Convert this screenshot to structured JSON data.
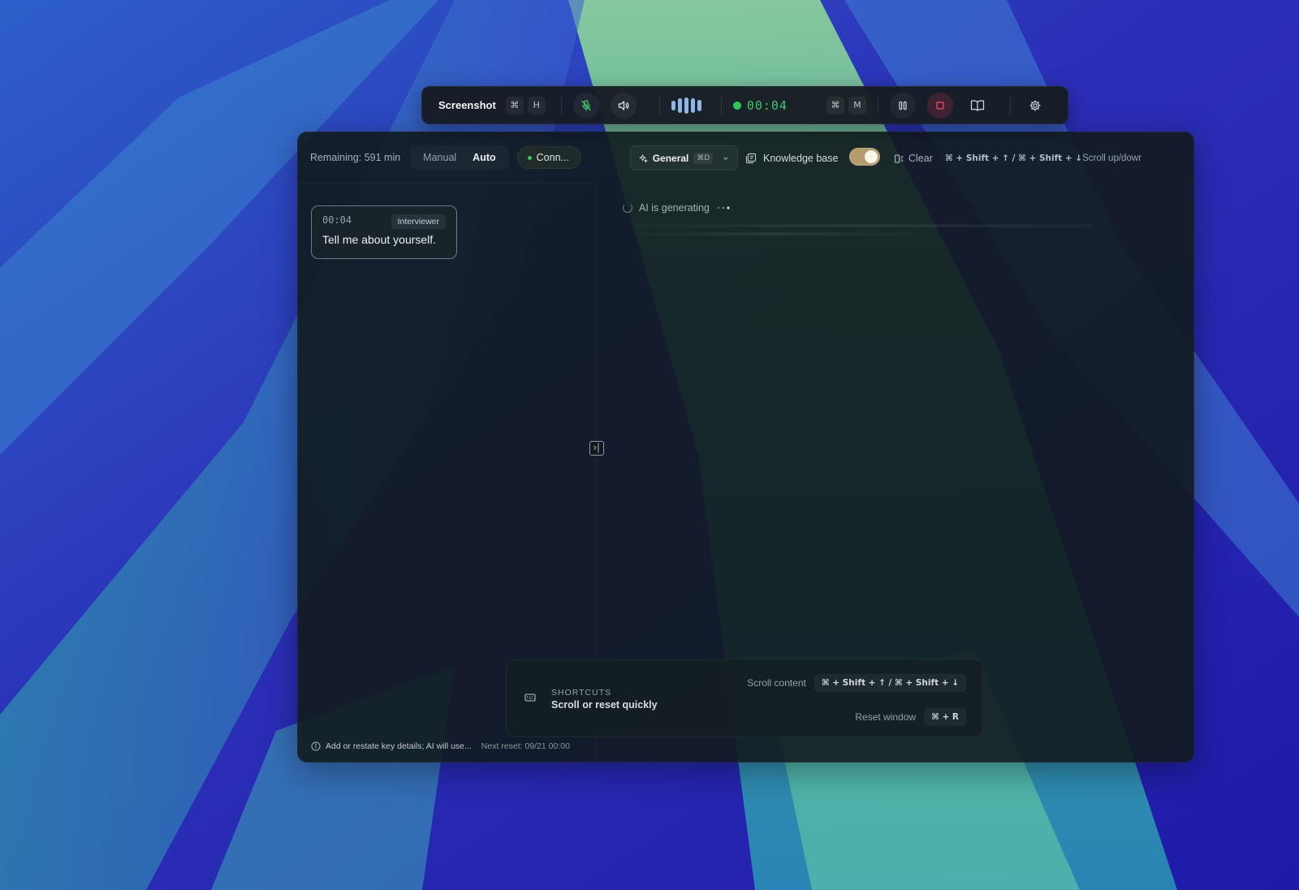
{
  "toolbar": {
    "screenshot_label": "Screenshot",
    "screenshot_keys": [
      "⌘",
      "H"
    ],
    "timer": "00:04",
    "marker_keys": [
      "⌘",
      "M"
    ]
  },
  "panel": {
    "remaining": "Remaining: 591 min",
    "modes": [
      "Manual",
      "Auto"
    ],
    "active_mode": "Auto",
    "connection": "Conn...",
    "assistant_mode": "General",
    "assistant_mode_shortcut": "⌘D",
    "knowledge_base_label": "Knowledge base",
    "knowledge_base_enabled": true,
    "clear_label": "Clear",
    "scroll_keys": "⌘ + Shift + ↑ / ⌘ + Shift + ↓",
    "scroll_label": "Scroll up/dowr"
  },
  "transcript": [
    {
      "time": "00:04",
      "speaker": "Interviewer",
      "text": "Tell me about yourself."
    }
  ],
  "ai": {
    "status": "AI is generating"
  },
  "shortcuts": {
    "kicker": "SHORTCUTS",
    "title": "Scroll or reset quickly",
    "scroll_label": "Scroll content",
    "scroll_keys": "⌘ + Shift + ↑ / ⌘ + Shift + ↓",
    "reset_label": "Reset window",
    "reset_keys": "⌘ + R"
  },
  "footer": {
    "note": "Add or restate key details; AI will use...",
    "next_reset": "Next reset: 09/21 00:00"
  },
  "colors": {
    "accent_green": "#2fc45c",
    "toggle_on": "#b59c6d",
    "stop_red": "#e0455c"
  }
}
